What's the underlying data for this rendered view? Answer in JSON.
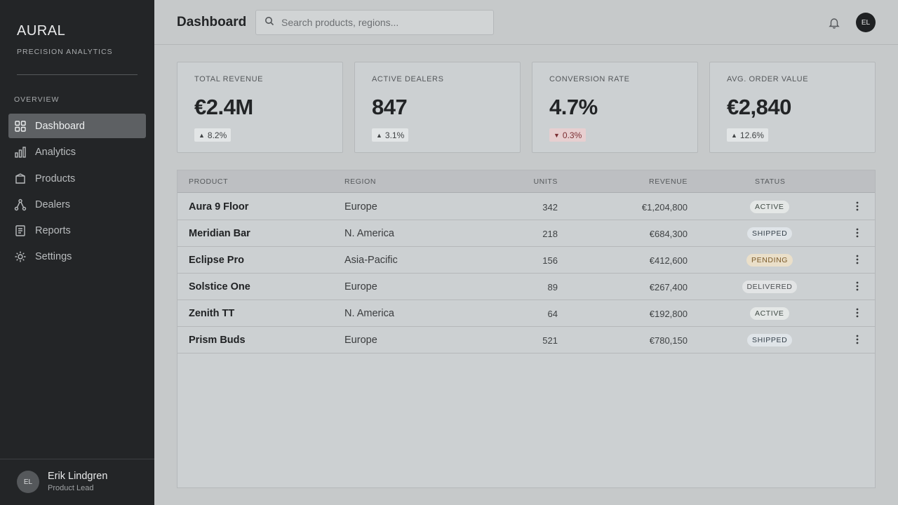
{
  "sidebar": {
    "brand": "AURAL",
    "tagline": "PRECISION ANALYTICS",
    "section_label": "OVERVIEW",
    "items": [
      {
        "label": "Dashboard",
        "icon": "grid-icon",
        "active": true
      },
      {
        "label": "Analytics",
        "icon": "bar-chart-icon",
        "active": false
      },
      {
        "label": "Products",
        "icon": "box-icon",
        "active": false
      },
      {
        "label": "Dealers",
        "icon": "network-icon",
        "active": false
      },
      {
        "label": "Reports",
        "icon": "document-icon",
        "active": false
      },
      {
        "label": "Settings",
        "icon": "gear-icon",
        "active": false
      }
    ],
    "user": {
      "initials": "EL",
      "name": "Erik Lindgren",
      "role": "Product Lead"
    }
  },
  "header": {
    "title": "Dashboard",
    "search_placeholder": "Search products, regions...",
    "avatar_initials": "EL"
  },
  "kpis": [
    {
      "label": "TOTAL REVENUE",
      "value": "€2.4M",
      "delta": "8.2%",
      "direction": "up"
    },
    {
      "label": "ACTIVE DEALERS",
      "value": "847",
      "delta": "3.1%",
      "direction": "up"
    },
    {
      "label": "CONVERSION RATE",
      "value": "4.7%",
      "delta": "0.3%",
      "direction": "down"
    },
    {
      "label": "AVG. ORDER VALUE",
      "value": "€2,840",
      "delta": "12.6%",
      "direction": "up"
    }
  ],
  "table": {
    "headers": {
      "product": "PRODUCT",
      "region": "REGION",
      "units": "UNITS",
      "revenue": "REVENUE",
      "status": "STATUS"
    },
    "rows": [
      {
        "product": "Aura 9 Floor",
        "region": "Europe",
        "units": "342",
        "revenue": "€1,204,800",
        "status": "ACTIVE"
      },
      {
        "product": "Meridian Bar",
        "region": "N. America",
        "units": "218",
        "revenue": "€684,300",
        "status": "SHIPPED"
      },
      {
        "product": "Eclipse Pro",
        "region": "Asia-Pacific",
        "units": "156",
        "revenue": "€412,600",
        "status": "PENDING"
      },
      {
        "product": "Solstice One",
        "region": "Europe",
        "units": "89",
        "revenue": "€267,400",
        "status": "DELIVERED"
      },
      {
        "product": "Zenith TT",
        "region": "N. America",
        "units": "64",
        "revenue": "€192,800",
        "status": "ACTIVE"
      },
      {
        "product": "Prism Buds",
        "region": "Europe",
        "units": "521",
        "revenue": "€780,150",
        "status": "SHIPPED"
      }
    ]
  },
  "status_colors": {
    "ACTIVE": {
      "bg": "#e4e7e6",
      "fg": "#3f4a44"
    },
    "SHIPPED": {
      "bg": "#dfe4e8",
      "fg": "#35414b"
    },
    "PENDING": {
      "bg": "#eadfc9",
      "fg": "#7a5a2a"
    },
    "DELIVERED": {
      "bg": "#e2e4e5",
      "fg": "#4a4d50"
    }
  }
}
